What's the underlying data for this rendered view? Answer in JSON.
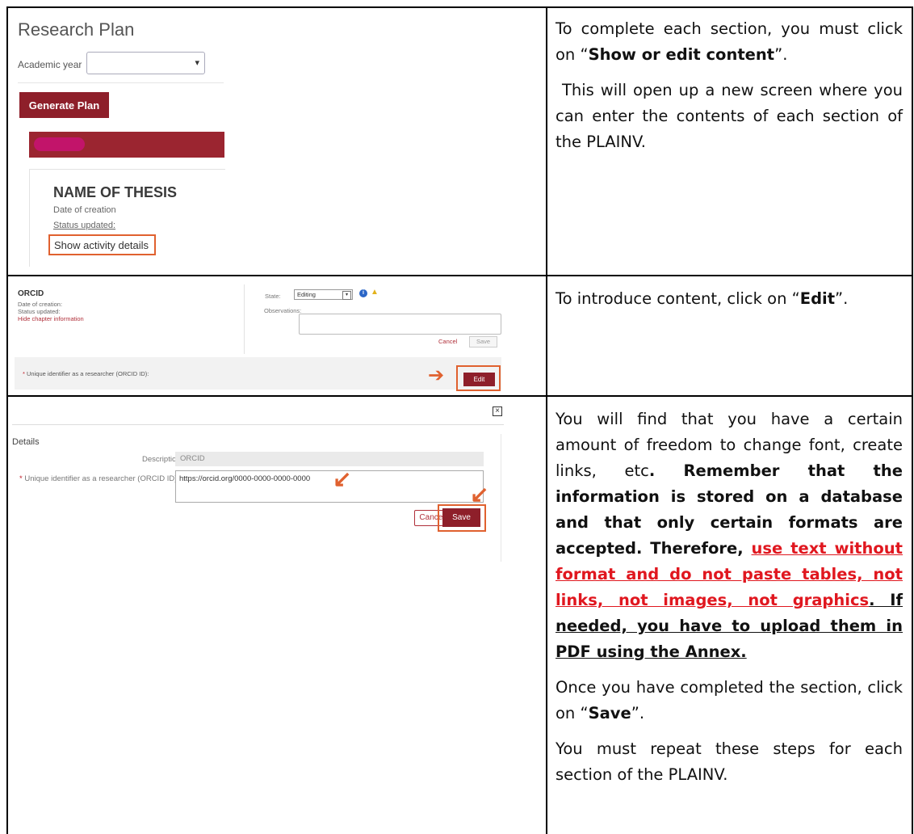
{
  "row1": {
    "screenshot": {
      "title": "Research Plan",
      "academic_year_label": "Academic year",
      "academic_year_value": "",
      "generate_button": "Generate Plan",
      "thesis_name": "NAME OF THESIS",
      "date_of_creation": "Date of creation",
      "status_updated": "Status updated:",
      "show_activity_details": "Show activity details"
    },
    "text": {
      "p1_pre": "To complete each section, you must click on “",
      "p1_bold": "Show or edit content",
      "p1_post": "”.",
      "p2": "This will open up a new screen where you can enter the contents of each section of the PLAINV."
    }
  },
  "row2": {
    "screenshot": {
      "section": "ORCID",
      "date_of_creation": "Date of creation:",
      "status_updated": "Status updated:",
      "hide_chapter": "Hide chapter information",
      "state_label": "State:",
      "state_value": "Editing",
      "observations_label": "Observations:",
      "cancel": "Cancel",
      "save": "Save",
      "unique_id_label": "Unique identifier as a researcher (ORCID ID):",
      "edit": "Edit"
    },
    "text": {
      "pre": "To introduce content, click on “",
      "bold": "Edit",
      "post": "”."
    }
  },
  "row3": {
    "screenshot": {
      "details": "Details",
      "description_label": "Description",
      "description_value": "ORCID",
      "unique_id_label": "Unique identifier as a researcher (ORCID ID)",
      "input_value": "https://orcid.org/0000-0000-0000-0000",
      "cancel": "Cancel",
      "save": "Save"
    },
    "text": {
      "p1_plain": "You will find that you have a certain amount of freedom to change font, create links, etc",
      "p1_bold": ". Remember that the information is stored on a database and that only certain formats are accepted. Therefore, ",
      "p1_red": "use text without format and do not paste tables, not links, not images, not graphics",
      "p1_tail": ". If needed, you have to upload them in PDF using the Annex.",
      "p2_pre": "Once you have completed the section, click on “",
      "p2_bold": "Save",
      "p2_post": "”.",
      "p3": "You must repeat these steps for each section of the PLAINV."
    }
  }
}
